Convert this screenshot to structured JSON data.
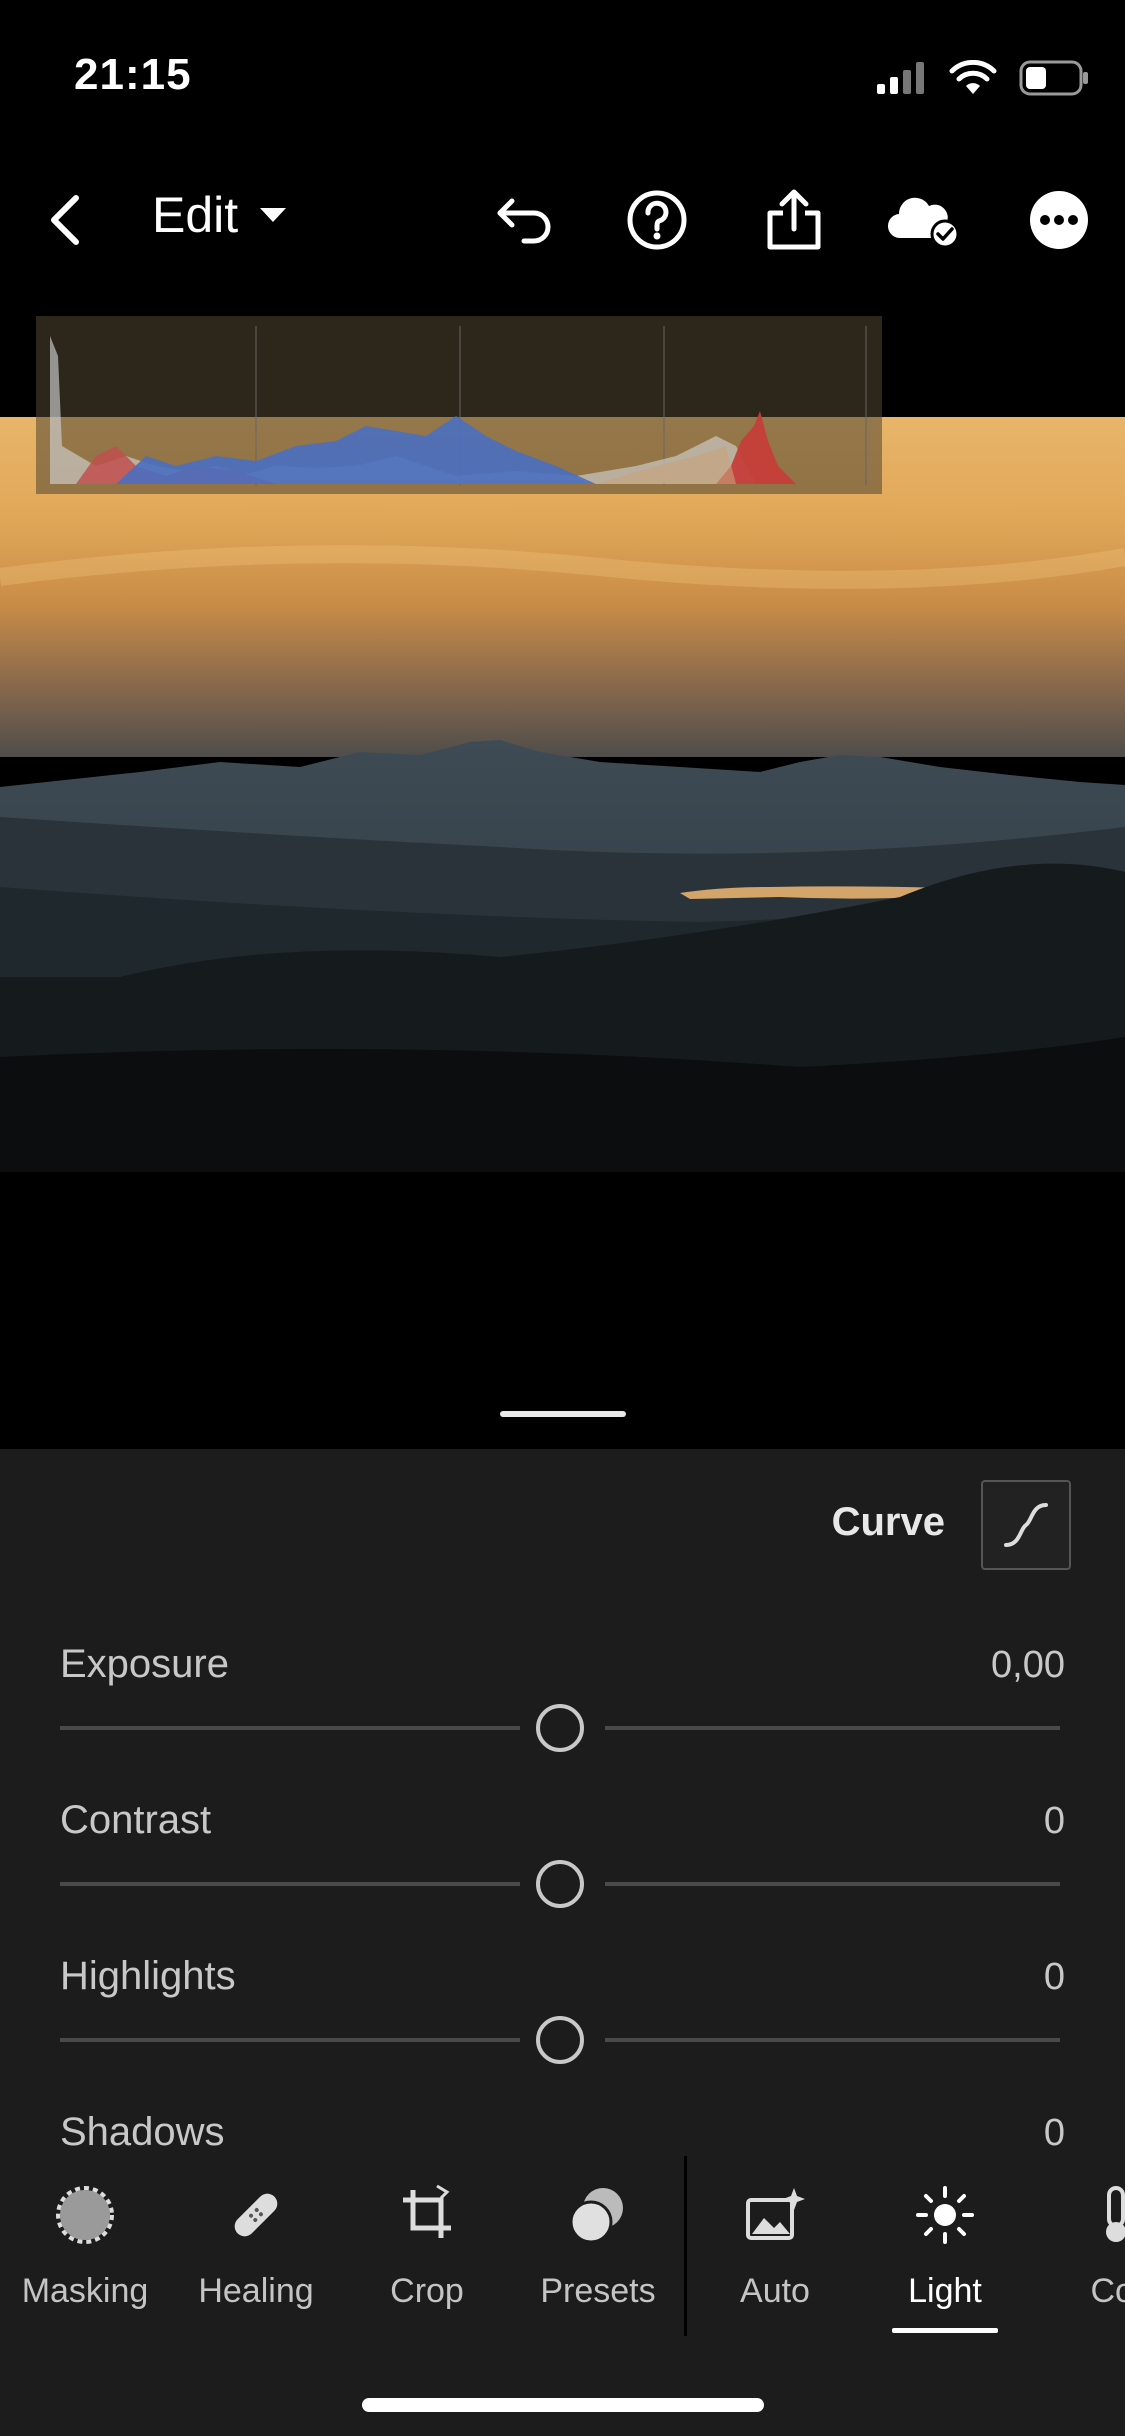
{
  "status_bar": {
    "time": "21:15"
  },
  "topbar": {
    "back_icon": "chevron-left-icon",
    "title": "Edit",
    "icons": [
      "undo-icon",
      "help-icon",
      "share-icon",
      "cloud-synced-icon",
      "more-icon"
    ]
  },
  "panel": {
    "curve_label": "Curve",
    "sliders": [
      {
        "label": "Exposure",
        "value": "0,00",
        "level": 0.5
      },
      {
        "label": "Contrast",
        "value": "0",
        "level": 0.5
      },
      {
        "label": "Highlights",
        "value": "0",
        "level": 0.5
      },
      {
        "label": "Shadows",
        "value": "0",
        "level": 0.5
      }
    ]
  },
  "toolbar": {
    "items": [
      {
        "label": "Masking",
        "icon": "masking-icon"
      },
      {
        "label": "Healing",
        "icon": "bandage-icon"
      },
      {
        "label": "Crop",
        "icon": "crop-icon"
      },
      {
        "label": "Presets",
        "icon": "presets-icon"
      },
      {
        "label": "Auto",
        "icon": "auto-image-icon"
      },
      {
        "label": "Light",
        "icon": "sun-icon",
        "active": true
      },
      {
        "label": "Col",
        "icon": "thermometer-icon"
      }
    ]
  },
  "colors": {
    "accent": "#ffffff",
    "panel_bg": "#1c1c1c",
    "label": "#c8c8c8"
  }
}
